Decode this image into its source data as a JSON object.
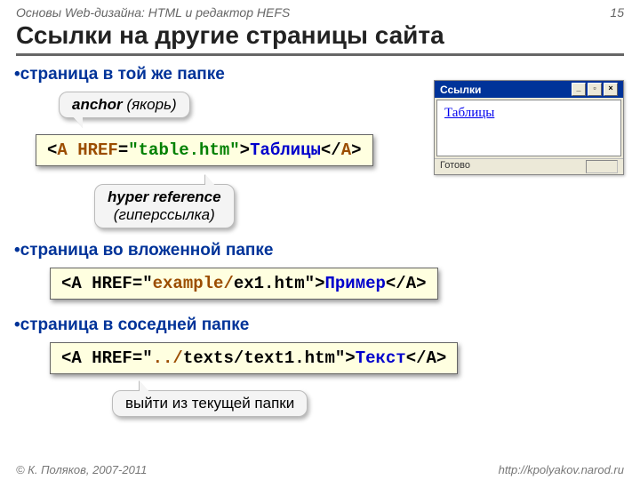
{
  "header": {
    "left": "Основы Web-дизайна: HTML и редактор HEFS",
    "right": "15"
  },
  "title": "Ссылки на другие страницы сайта",
  "section1": {
    "heading": "страница в той же папке",
    "callout_anchor_b": "anchor",
    "callout_anchor_i": " (якорь)",
    "code_open1": "<",
    "code_tag": "A",
    "code_sp": " ",
    "code_attr": "HREF",
    "code_eq": "=",
    "code_val": "\"table.htm\"",
    "code_gt": ">",
    "code_link": "Таблицы",
    "code_close": "</",
    "code_tag2": "A",
    "code_end": ">",
    "callout_hyper_b": "hyper reference",
    "callout_hyper_i": "(гиперссылка)"
  },
  "section2": {
    "heading": "страница во вложенной папке",
    "code_open": "<A HREF=",
    "code_q1": "\"",
    "code_dir": "example/",
    "code_file": "ex1.htm",
    "code_q2": "\"",
    "code_gt": ">",
    "code_link": "Пример",
    "code_close": "</A>"
  },
  "section3": {
    "heading": "страница в соседней папке",
    "code_open": "<A HREF=",
    "code_q1": "\"",
    "code_up": "../",
    "code_rest": "texts/text1.htm",
    "code_q2": "\"",
    "code_gt": ">",
    "code_link": "Текст",
    "code_close": "</A>",
    "callout": "выйти из текущей папки"
  },
  "browser": {
    "title": "Ссылки",
    "link": "Таблицы",
    "status": "Готово"
  },
  "footer": {
    "left": "© К. Поляков, 2007-2011",
    "right": "http://kpolyakov.narod.ru"
  }
}
